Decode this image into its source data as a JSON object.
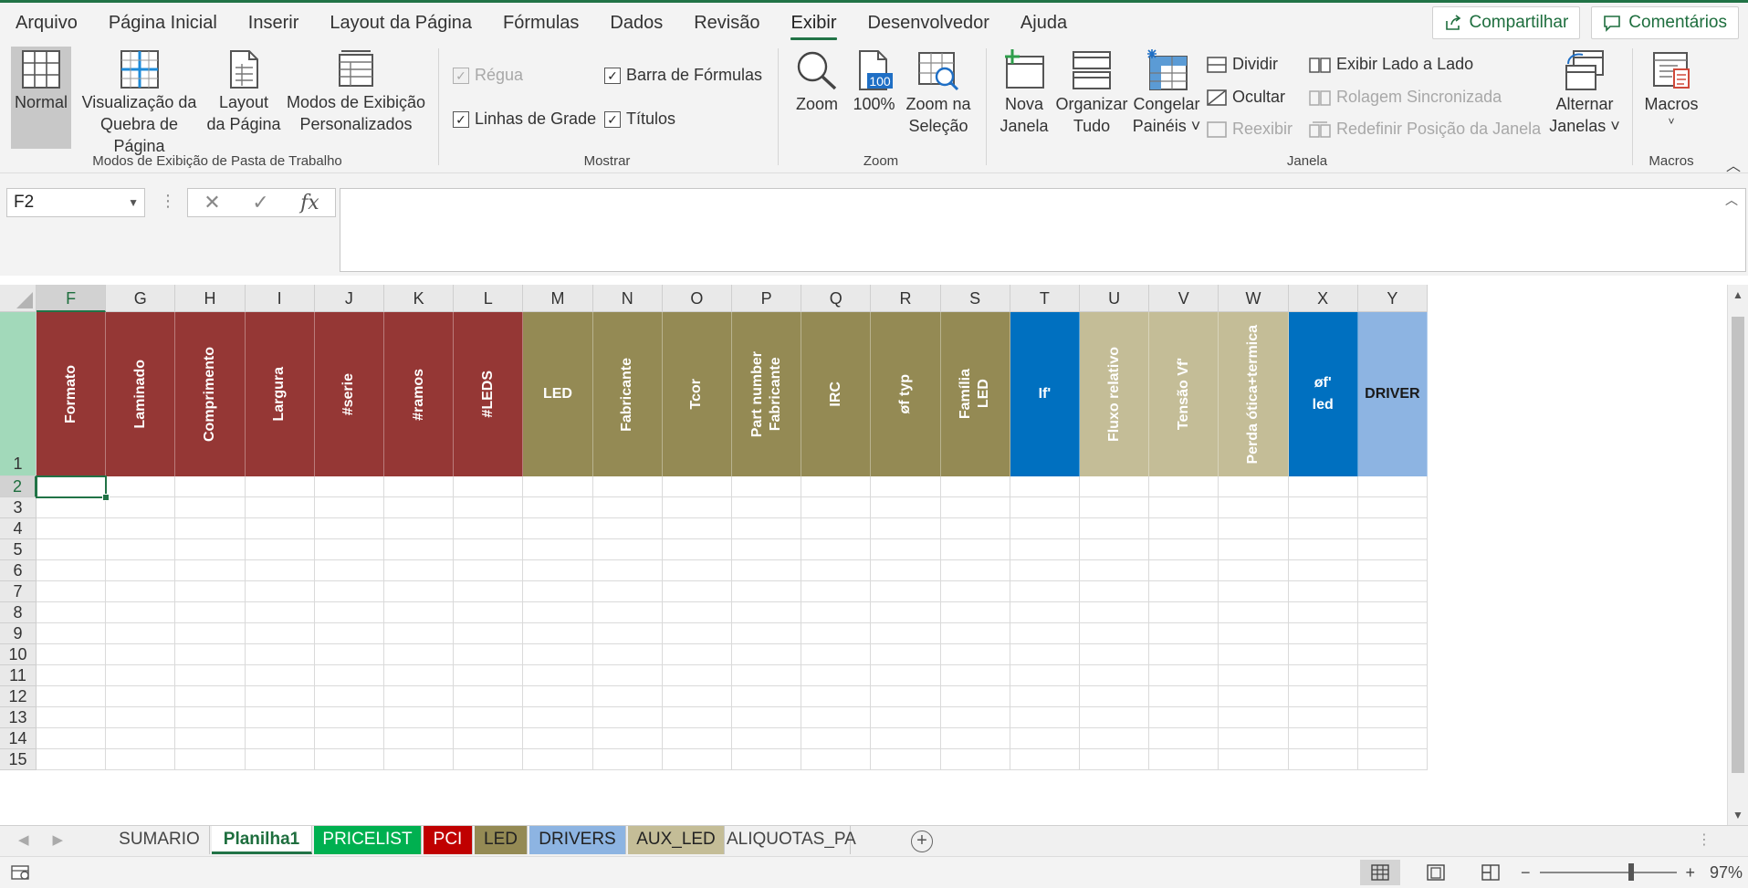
{
  "menu": [
    "Arquivo",
    "Página Inicial",
    "Inserir",
    "Layout da Página",
    "Fórmulas",
    "Dados",
    "Revisão",
    "Exibir",
    "Desenvolvedor",
    "Ajuda"
  ],
  "active_menu_index": 7,
  "top_buttons": {
    "share": "Compartilhar",
    "comments": "Comentários"
  },
  "ribbon": {
    "workbook_views": {
      "normal": "Normal",
      "page_break": "Visualização da\nQuebra de Página",
      "page_layout": "Layout\nda Página",
      "custom": "Modos de Exibição\nPersonalizados",
      "group_label": "Modos de Exibição de Pasta de Trabalho"
    },
    "show": {
      "ruler": "Régua",
      "formula_bar": "Barra de Fórmulas",
      "gridlines": "Linhas de Grade",
      "headings": "Títulos",
      "group_label": "Mostrar"
    },
    "zoom": {
      "zoom": "Zoom",
      "hundred": "100%",
      "hundred_icon_text": "100",
      "to_selection": "Zoom na\nSeleção",
      "group_label": "Zoom"
    },
    "window": {
      "new_window": "Nova\nJanela",
      "arrange_all": "Organizar\nTudo",
      "freeze": "Congelar\nPainéis ˅",
      "split": "Dividir",
      "hide": "Ocultar",
      "unhide": "Reexibir",
      "side_by_side": "Exibir Lado a Lado",
      "sync_scroll": "Rolagem Sincronizada",
      "reset_position": "Redefinir Posição da Janela",
      "switch": "Alternar\nJanelas ˅",
      "group_label": "Janela"
    },
    "macros": {
      "macros": "Macros",
      "group_label": "Macros"
    }
  },
  "formula_bar": {
    "name_box": "F2",
    "formula": "",
    "fx": "fx"
  },
  "columns": [
    {
      "letter": "F",
      "header": "Formato",
      "color": "#953735",
      "rot": true
    },
    {
      "letter": "G",
      "header": "Laminado",
      "color": "#953735",
      "rot": true
    },
    {
      "letter": "H",
      "header": "Comprimento",
      "color": "#953735",
      "rot": true
    },
    {
      "letter": "I",
      "header": "Largura",
      "color": "#953735",
      "rot": true
    },
    {
      "letter": "J",
      "header": "#serie",
      "color": "#953735",
      "rot": true
    },
    {
      "letter": "K",
      "header": "#ramos",
      "color": "#953735",
      "rot": true
    },
    {
      "letter": "L",
      "header": "#LEDS",
      "color": "#953735",
      "rot": true
    },
    {
      "letter": "M",
      "header": "LED",
      "color": "#948a54",
      "rot": false
    },
    {
      "letter": "N",
      "header": "Fabricante",
      "color": "#948a54",
      "rot": true
    },
    {
      "letter": "O",
      "header": "Tcor",
      "color": "#948a54",
      "rot": true
    },
    {
      "letter": "P",
      "header": "Part number\nFabricante",
      "color": "#948a54",
      "rot": true
    },
    {
      "letter": "Q",
      "header": "IRC",
      "color": "#948a54",
      "rot": true
    },
    {
      "letter": "R",
      "header": "øf typ",
      "color": "#948a54",
      "rot": true
    },
    {
      "letter": "S",
      "header": "Família\nLED",
      "color": "#948a54",
      "rot": true
    },
    {
      "letter": "T",
      "header": "If'",
      "color": "#0070c0",
      "rot": false
    },
    {
      "letter": "U",
      "header": "Fluxo relativo",
      "color": "#c4bd97",
      "rot": true
    },
    {
      "letter": "V",
      "header": "Tensão Vf'",
      "color": "#c4bd97",
      "rot": true
    },
    {
      "letter": "W",
      "header": "Perda ótica+termica",
      "color": "#c4bd97",
      "rot": true
    },
    {
      "letter": "X",
      "header": "øf'\nled",
      "color": "#0070c0",
      "rot": false
    },
    {
      "letter": "Y",
      "header": "DRIVER",
      "color": "#8db4e2",
      "rot": false,
      "dark": true
    }
  ],
  "rows": [
    "1",
    "2",
    "3",
    "4",
    "5",
    "6",
    "7",
    "8",
    "9",
    "10",
    "11",
    "12",
    "13",
    "14",
    "15"
  ],
  "active_cell": "F2",
  "sheets": [
    {
      "name": "SUMARIO",
      "color": ""
    },
    {
      "name": "Planilha1",
      "color": "",
      "active": true
    },
    {
      "name": "PRICELIST",
      "color": "#00b050"
    },
    {
      "name": "PCI",
      "color": "#c00000"
    },
    {
      "name": "LED",
      "color": "#948a54"
    },
    {
      "name": "DRIVERS",
      "color": "#8db4e2"
    },
    {
      "name": "AUX_LED",
      "color": "#c4bd97"
    },
    {
      "name": "ALIQUOTAS_PA",
      "color": ""
    }
  ],
  "status": {
    "zoom_minus": "−",
    "zoom_plus": "+",
    "zoom_level": "97%"
  }
}
